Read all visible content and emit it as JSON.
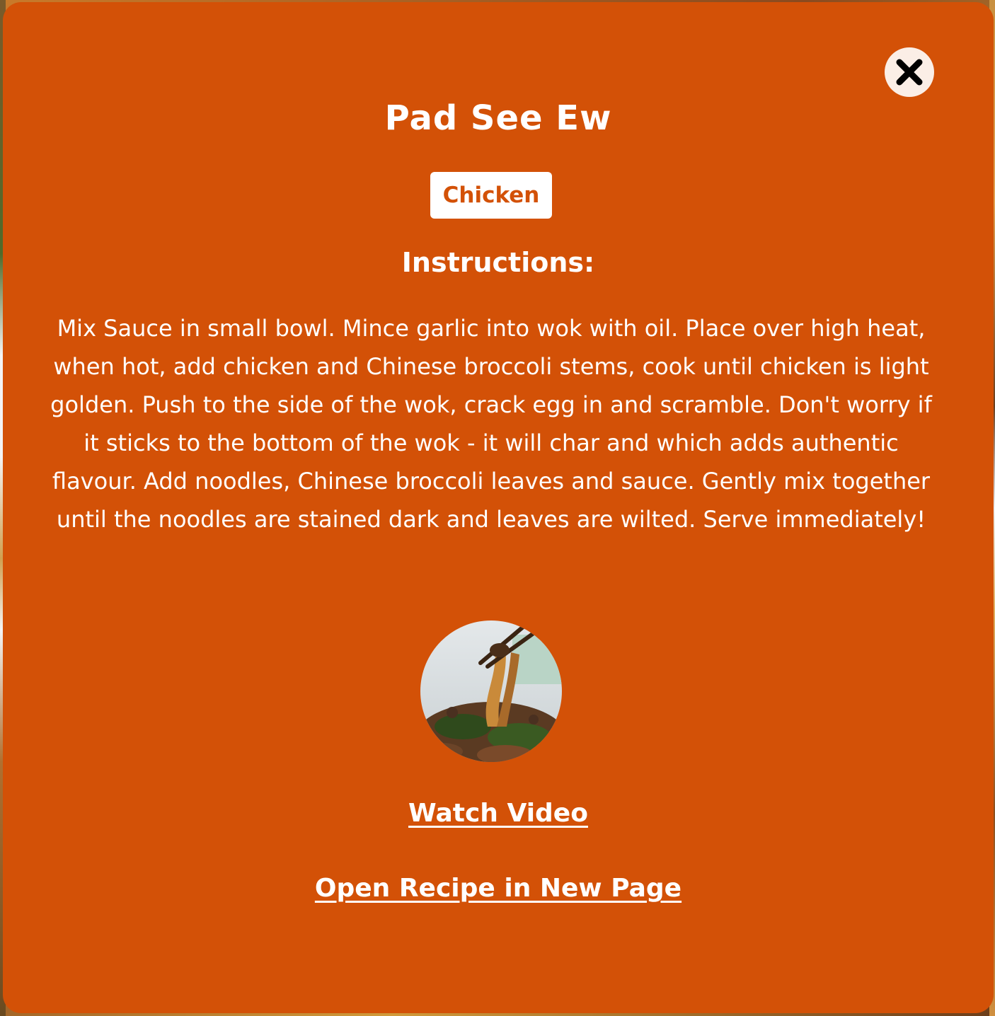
{
  "modal": {
    "title": "Pad See Ew",
    "category": "Chicken",
    "instructions_heading": "Instructions:",
    "instructions": "Mix Sauce in small bowl. Mince garlic into wok with oil. Place over high heat, when hot, add chicken and Chinese broccoli stems, cook until chicken is light golden. Push to the side of the wok, crack egg in and scramble. Don't worry if it sticks to the bottom of the wok - it will char and which adds authentic flavour. Add noodles, Chinese broccoli leaves and sauce. Gently mix together until the noodles are stained dark and leaves are wilted. Serve immediately!",
    "watch_video_label": "Watch Video",
    "open_recipe_label": "Open Recipe in New Page",
    "close_icon": "close-icon",
    "image_alt": "Pad See Ew"
  },
  "colors": {
    "modal_bg": "#d35107",
    "text": "#ffffff",
    "badge_bg": "#ffffff",
    "badge_text": "#d35107",
    "close_bg": "#fbeee6"
  }
}
